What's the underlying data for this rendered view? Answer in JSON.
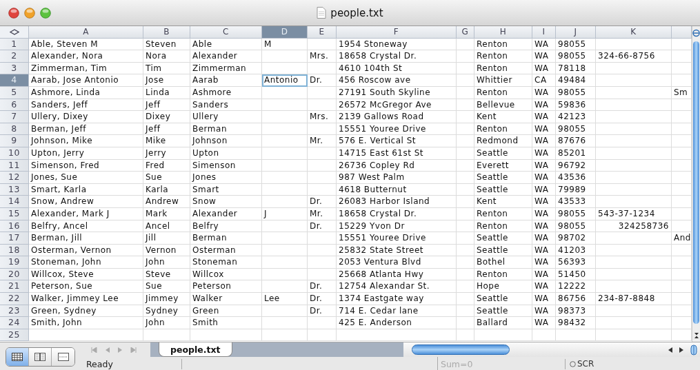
{
  "window": {
    "title": "people.txt"
  },
  "columns": [
    {
      "label": "A",
      "selected": false
    },
    {
      "label": "B",
      "selected": false
    },
    {
      "label": "C",
      "selected": false
    },
    {
      "label": "D",
      "selected": true
    },
    {
      "label": "E",
      "selected": false
    },
    {
      "label": "F",
      "selected": false
    },
    {
      "label": "G",
      "selected": false
    },
    {
      "label": "H",
      "selected": false
    },
    {
      "label": "I",
      "selected": false
    },
    {
      "label": "J",
      "selected": false
    },
    {
      "label": "K",
      "selected": false
    },
    {
      "selected": false
    }
  ],
  "rows": [
    {
      "number": "1",
      "selected": false,
      "cells": [
        "Able, Steven M",
        "Steven",
        "Able",
        "M",
        null,
        "1954 Stoneway",
        null,
        "Renton",
        "WA",
        "98055",
        null,
        null
      ]
    },
    {
      "number": "2",
      "selected": false,
      "cells": [
        "Alexander, Nora",
        "Nora",
        "Alexander",
        null,
        "Mrs.",
        "18658 Crystal Dr.",
        null,
        "Renton",
        "WA",
        "98055",
        "324-66-8756",
        null
      ]
    },
    {
      "number": "3",
      "selected": false,
      "cells": [
        "Zimmerman, Tim",
        "Tim",
        "Zimmerman",
        null,
        null,
        "4610 104th St",
        null,
        "Renton",
        "WA",
        "78118",
        null,
        null
      ]
    },
    {
      "number": "4",
      "selected": true,
      "cells": [
        "Aarab, Jose Antonio",
        "Jose",
        "Aarab",
        "Antonio",
        "Dr.",
        "456 Roscow ave",
        null,
        "Whittier",
        "CA",
        "49484",
        null,
        null
      ]
    },
    {
      "number": "5",
      "selected": false,
      "cells": [
        "Ashmore, Linda",
        "Linda",
        "Ashmore",
        null,
        null,
        "27191 South Skyline",
        null,
        "Renton",
        "WA",
        "98055",
        null,
        "Sm"
      ]
    },
    {
      "number": "6",
      "selected": false,
      "cells": [
        "Sanders, Jeff",
        "Jeff",
        "Sanders",
        null,
        null,
        "26572 McGregor Ave",
        null,
        "Bellevue",
        "WA",
        "59836",
        null,
        null
      ]
    },
    {
      "number": "7",
      "selected": false,
      "cells": [
        "Ullery, Dixey",
        "Dixey",
        "Ullery",
        null,
        "Mrs.",
        "2139 Gallows Road",
        null,
        "Kent",
        "WA",
        "42123",
        null,
        null
      ]
    },
    {
      "number": "8",
      "selected": false,
      "cells": [
        "Berman, Jeff",
        "Jeff",
        "Berman",
        null,
        null,
        "15551 Youree Drive",
        null,
        "Renton",
        "WA",
        "98055",
        null,
        null
      ]
    },
    {
      "number": "9",
      "selected": false,
      "cells": [
        "Johnson, Mike",
        "Mike",
        "Johnson",
        null,
        "Mr.",
        "576 E. Vertical St",
        null,
        "Redmond",
        "WA",
        "87676",
        null,
        null
      ]
    },
    {
      "number": "10",
      "selected": false,
      "cells": [
        "Upton, Jerry",
        "Jerry",
        "Upton",
        null,
        null,
        "14715 East 61st St",
        null,
        "Seattle",
        "WA",
        "85201",
        null,
        null
      ]
    },
    {
      "number": "11",
      "selected": false,
      "cells": [
        "Simenson, Fred",
        "Fred",
        "Simenson",
        null,
        null,
        "26736 Copley Rd",
        null,
        "Everett",
        "WA",
        "96792",
        null,
        null
      ]
    },
    {
      "number": "12",
      "selected": false,
      "cells": [
        "Jones, Sue",
        "Sue",
        "Jones",
        null,
        null,
        "987 West Palm",
        null,
        "Seattle",
        "WA",
        "43536",
        null,
        null
      ]
    },
    {
      "number": "13",
      "selected": false,
      "cells": [
        "Smart, Karla",
        "Karla",
        "Smart",
        null,
        null,
        "4618 Butternut",
        null,
        "Seattle",
        "WA",
        "79989",
        null,
        null
      ]
    },
    {
      "number": "14",
      "selected": false,
      "cells": [
        "Snow, Andrew",
        "Andrew",
        "Snow",
        null,
        "Dr.",
        "26083 Harbor Island",
        null,
        "Kent",
        "WA",
        "43533",
        null,
        null
      ]
    },
    {
      "number": "15",
      "selected": false,
      "cells": [
        "Alexander, Mark J",
        "Mark",
        "Alexander",
        "J",
        "Mr.",
        "18658 Crystal Dr.",
        null,
        "Renton",
        "WA",
        "98055",
        "543-37-1234",
        null
      ]
    },
    {
      "number": "16",
      "selected": false,
      "cells": [
        "Belfry, Ancel",
        "Ancel",
        "Belfry",
        null,
        "Dr.",
        "15229 Yvon Dr",
        null,
        "Renton",
        "WA",
        "98055",
        {
          "text": "324258736",
          "kind": "number"
        },
        null
      ]
    },
    {
      "number": "17",
      "selected": false,
      "cells": [
        "Berman, Jill",
        "Jill",
        "Berman",
        null,
        null,
        "15551 Youree Drive",
        null,
        "Seattle",
        "WA",
        "98702",
        null,
        "And"
      ]
    },
    {
      "number": "18",
      "selected": false,
      "cells": [
        "Osterman, Vernon",
        "Vernon",
        "Osterman",
        null,
        null,
        "25832 State Street",
        null,
        "Seattle",
        "WA",
        "41203",
        null,
        null
      ]
    },
    {
      "number": "19",
      "selected": false,
      "cells": [
        "Stoneman, John",
        "John",
        "Stoneman",
        null,
        null,
        "2053 Ventura Blvd",
        null,
        "Bothel",
        "WA",
        "56393",
        null,
        null
      ]
    },
    {
      "number": "20",
      "selected": false,
      "cells": [
        "Willcox, Steve",
        "Steve",
        "Willcox",
        null,
        null,
        "25668 Atlanta Hwy",
        null,
        "Renton",
        "WA",
        "51450",
        null,
        null
      ]
    },
    {
      "number": "21",
      "selected": false,
      "cells": [
        "Peterson, Sue",
        "Sue",
        "Peterson",
        null,
        "Dr.",
        "12754 Alexandar St.",
        null,
        "Hope",
        "WA",
        "12222",
        null,
        null
      ]
    },
    {
      "number": "22",
      "selected": false,
      "cells": [
        "Walker, Jimmey Lee",
        "Jimmey",
        "Walker",
        "Lee",
        "Dr.",
        "1374 Eastgate way",
        null,
        "Seattle",
        "WA",
        "86756",
        "234-87-8848",
        null
      ]
    },
    {
      "number": "23",
      "selected": false,
      "cells": [
        "Green, Sydney",
        "Sydney",
        "Green",
        null,
        "Dr.",
        "714 E. Cedar lane",
        null,
        "Seattle",
        "WA",
        "98373",
        null,
        null
      ]
    },
    {
      "number": "24",
      "selected": false,
      "cells": [
        "Smith, John",
        "John",
        "Smith",
        null,
        null,
        "425 E. Anderson",
        null,
        "Ballard",
        "WA",
        "98432",
        null,
        null
      ]
    },
    {
      "number": "25",
      "selected": false,
      "cells": [
        null,
        null,
        null,
        null,
        null,
        null,
        null,
        null,
        null,
        null,
        null,
        null
      ]
    }
  ],
  "view_buttons": [
    {
      "selected": true
    },
    {
      "selected": false
    },
    {
      "selected": false
    }
  ],
  "sheet_tabs": [
    {
      "label": "people.txt",
      "selected": true
    }
  ],
  "status_bar": {
    "status": "Ready",
    "sum": "Sum=0",
    "scroll_lock": "SCR"
  }
}
